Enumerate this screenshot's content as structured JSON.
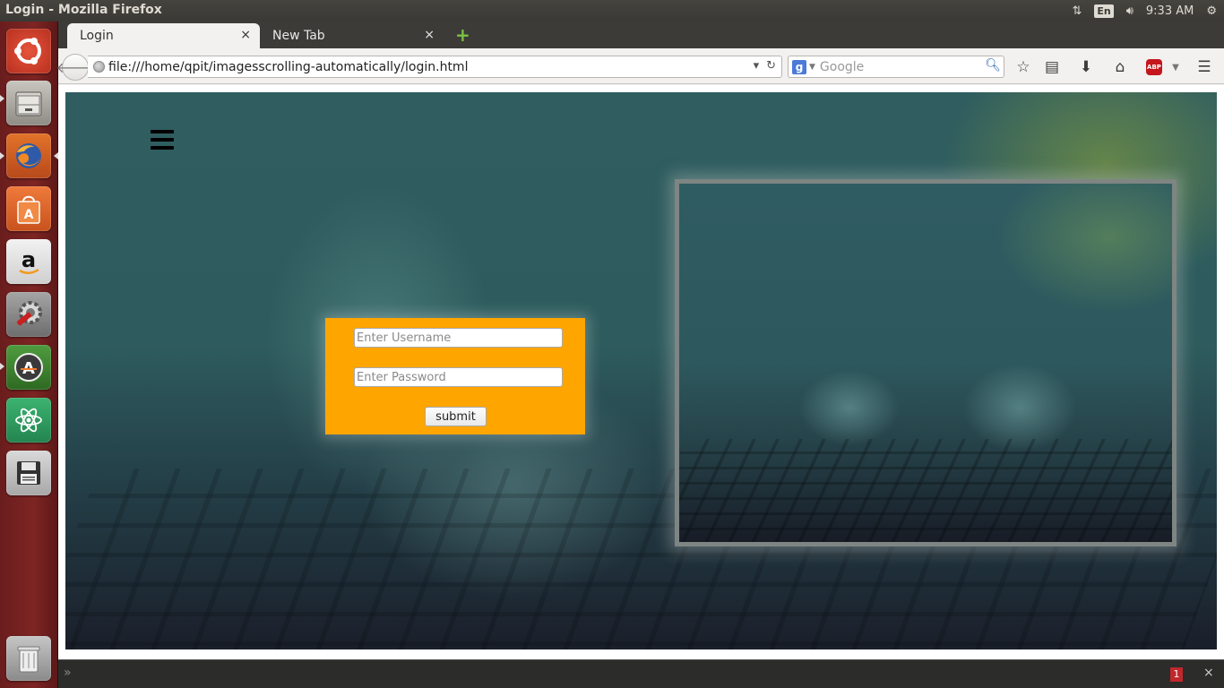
{
  "window": {
    "title": "Login - Mozilla Firefox"
  },
  "tray": {
    "lang": "En",
    "time": "9:33 AM"
  },
  "tabs": [
    {
      "label": "Login",
      "close": "×"
    },
    {
      "label": "New Tab",
      "close": "×"
    }
  ],
  "newtab_label": "+",
  "urlbar": {
    "url": "file:///home/qpit/imagesscrolling-automatically/login.html"
  },
  "search": {
    "engine": "g",
    "placeholder": "Google"
  },
  "addon": {
    "label": "ABP"
  },
  "login": {
    "username_placeholder": "Enter Username",
    "password_placeholder": "Enter Password",
    "submit_label": "submit"
  },
  "bottombar": {
    "badge": "1",
    "close": "×",
    "toggle": "»"
  },
  "launcher": {
    "items": [
      "ubuntu-dash",
      "files",
      "firefox",
      "software-center",
      "amazon",
      "system-settings",
      "software-updater",
      "atom",
      "save-drive",
      "trash"
    ]
  },
  "colors": {
    "form_bg": "#ffa500",
    "launcher_bg": "#7d2523"
  }
}
